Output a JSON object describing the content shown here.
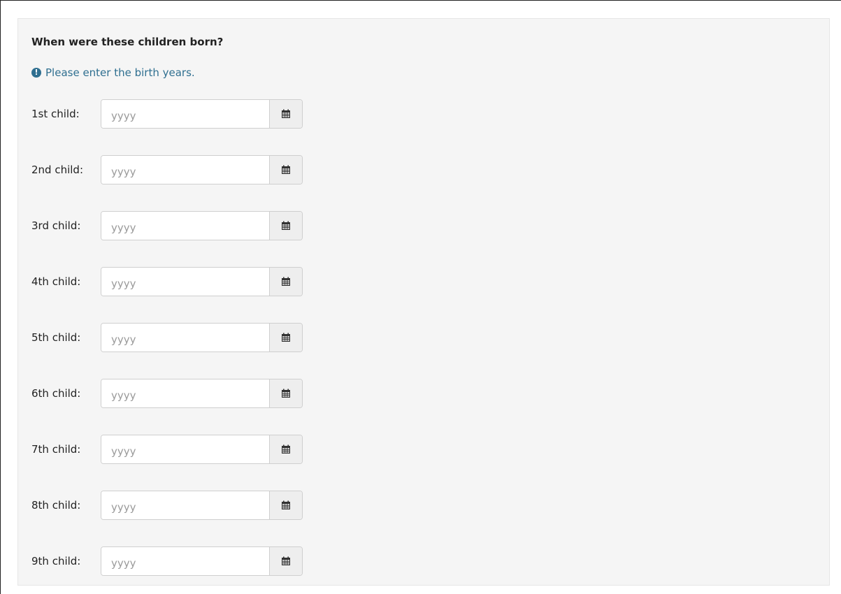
{
  "form": {
    "question": "When were these children born?",
    "hint": "Please enter the birth years.",
    "hint_icon": "exclamation-circle-icon",
    "calendar_icon": "calendar-icon",
    "colors": {
      "panel_bg": "#f5f5f5",
      "hint_text": "#2f6f90",
      "addon_bg": "#eeeeee"
    },
    "children": [
      {
        "label": "1st child:",
        "value": "",
        "placeholder": "yyyy"
      },
      {
        "label": "2nd child:",
        "value": "",
        "placeholder": "yyyy"
      },
      {
        "label": "3rd child:",
        "value": "",
        "placeholder": "yyyy"
      },
      {
        "label": "4th child:",
        "value": "",
        "placeholder": "yyyy"
      },
      {
        "label": "5th child:",
        "value": "",
        "placeholder": "yyyy"
      },
      {
        "label": "6th child:",
        "value": "",
        "placeholder": "yyyy"
      },
      {
        "label": "7th child:",
        "value": "",
        "placeholder": "yyyy"
      },
      {
        "label": "8th child:",
        "value": "",
        "placeholder": "yyyy"
      },
      {
        "label": "9th child:",
        "value": "",
        "placeholder": "yyyy"
      }
    ]
  }
}
